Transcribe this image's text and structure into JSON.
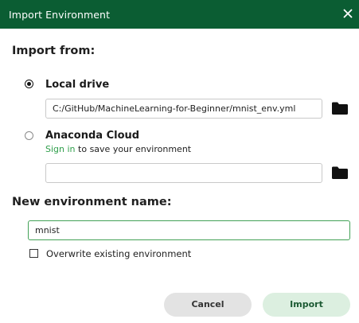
{
  "dialog": {
    "title": "Import Environment",
    "import_from_heading": "Import from:",
    "options": {
      "local": {
        "label": "Local drive",
        "selected": true,
        "path_value": "C:/GitHub/MachineLearning-for-Beginner/mnist_env.yml"
      },
      "cloud": {
        "label": "Anaconda Cloud",
        "selected": false,
        "signin_link": "Sign in",
        "signin_suffix": " to save your environment",
        "path_value": ""
      }
    },
    "new_name_heading": "New environment name:",
    "name_value": "mnist",
    "overwrite_label": "Overwrite existing environment",
    "overwrite_checked": false,
    "buttons": {
      "cancel": "Cancel",
      "import": "Import"
    }
  },
  "colors": {
    "titlebar": "#0b5d33",
    "accent": "#2e9e4a",
    "import_button": "#dcefe0",
    "cancel_button": "#e3e3e3"
  },
  "icons": [
    "close-icon",
    "folder-icon"
  ]
}
